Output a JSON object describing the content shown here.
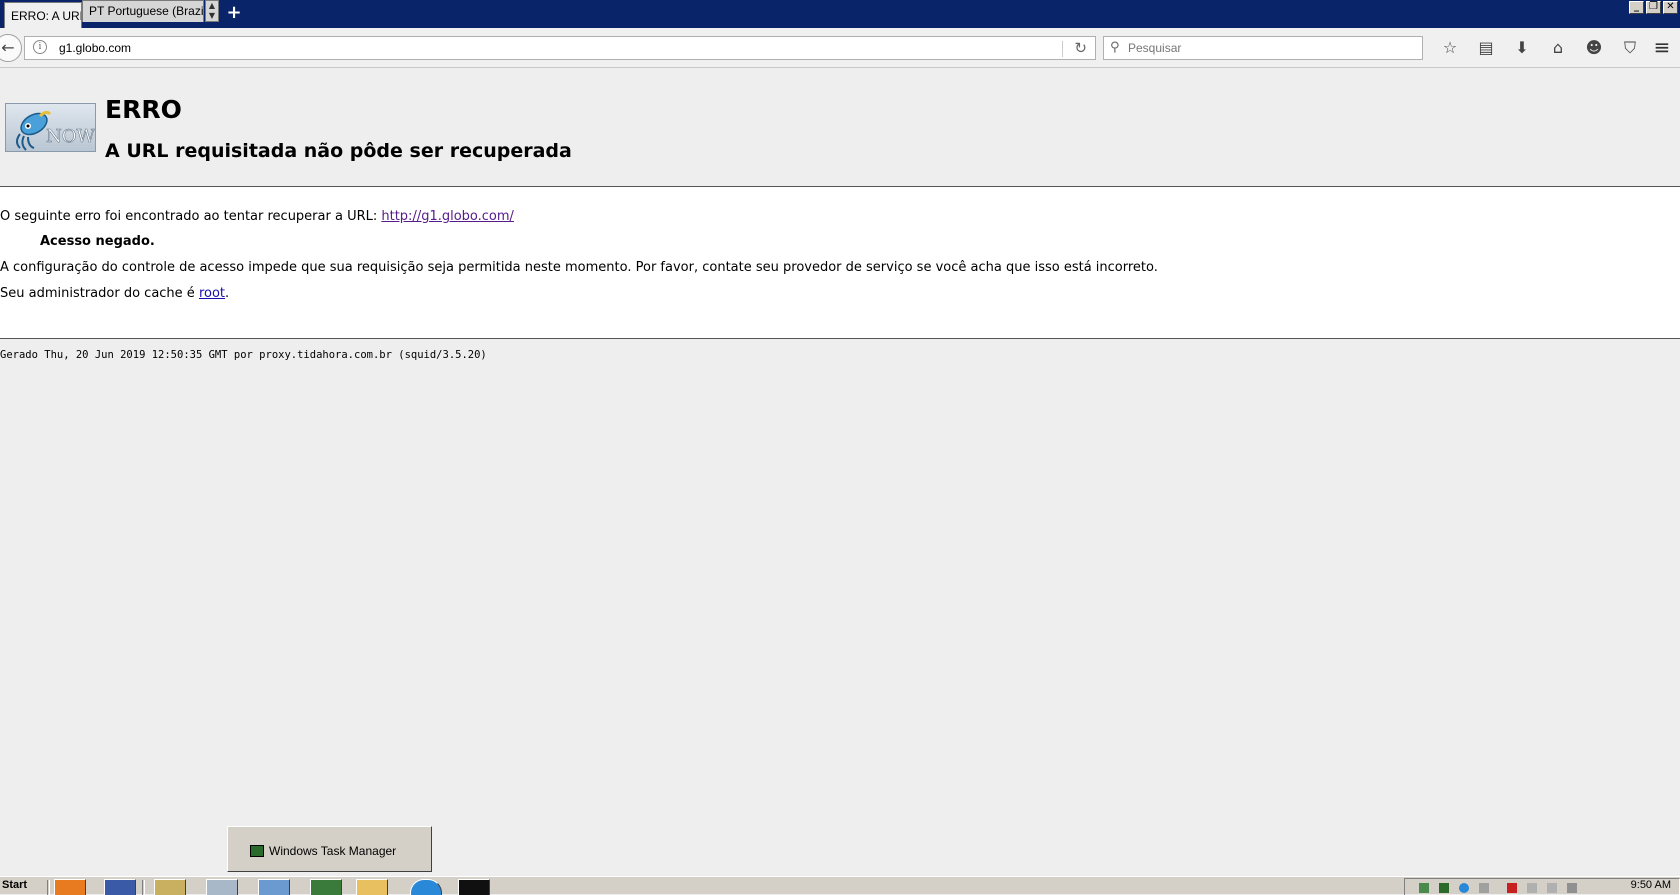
{
  "browser": {
    "tabs": [
      {
        "label": "ERRO: A URL",
        "active": true
      },
      {
        "label": "PT Portuguese (Brazil)",
        "active": false
      }
    ],
    "new_tab_label": "+",
    "url": "g1.globo.com",
    "search_placeholder": "Pesquisar"
  },
  "page": {
    "title": "ERRO",
    "subtitle": "A URL requisitada não pôde ser recuperada",
    "logo_text": "NOW",
    "error_intro": "O seguinte erro foi encontrado ao tentar recuperar a URL: ",
    "error_url": "http://g1.globo.com/",
    "error_reason": "Acesso negado.",
    "explanation": "A configuração do controle de acesso impede que sua requisição seja permitida neste momento. Por favor, contate seu provedor de serviço se você acha que isso está incorreto.",
    "admin_prefix": "Seu administrador do cache é ",
    "admin_link": "root",
    "admin_suffix": ".",
    "footer": "Gerado Thu, 20 Jun 2019 12:50:35 GMT por proxy.tidahora.com.br (squid/3.5.20)"
  },
  "taskbar": {
    "start_label": "Start",
    "popup_item": "Windows Task Manager",
    "clock": "9:50 AM"
  },
  "colors": {
    "titlebar": "#0a246a",
    "link_visited": "#551a8b",
    "link": "#1a0dab",
    "page_bg": "#eeeeee"
  }
}
